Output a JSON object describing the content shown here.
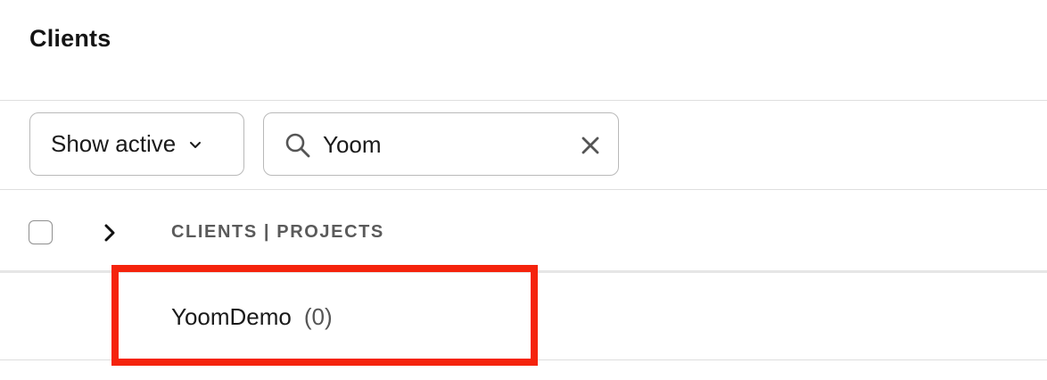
{
  "page": {
    "title": "Clients"
  },
  "filters": {
    "status_select": {
      "value": "Show active",
      "icon": "chevron-down-icon"
    },
    "search": {
      "value": "Yoom",
      "icon": "search-icon",
      "clear_icon": "close-icon"
    }
  },
  "table": {
    "header": {
      "columns_label": "CLIENTS | PROJECTS"
    },
    "rows": [
      {
        "name": "YoomDemo",
        "count": "(0)"
      }
    ]
  },
  "colors": {
    "highlight": "#f5230c",
    "border": "#b9b9b9",
    "divider": "#dedede"
  }
}
